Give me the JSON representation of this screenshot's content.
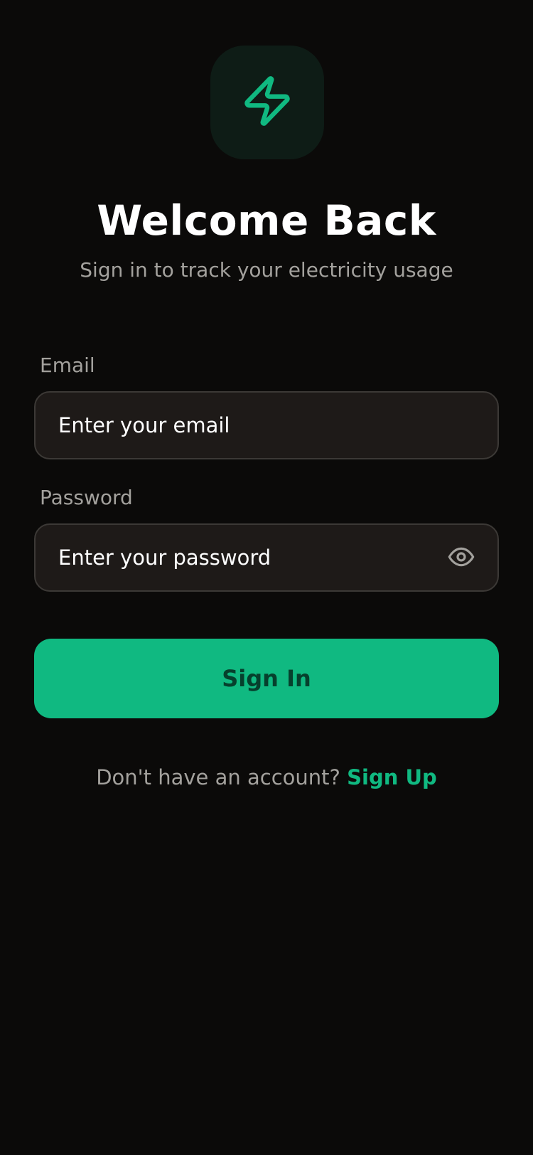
{
  "header": {
    "icon": "lightning-bolt-icon",
    "title": "Welcome Back",
    "subtitle": "Sign in to track your electricity usage"
  },
  "form": {
    "email": {
      "label": "Email",
      "value": "",
      "placeholder": "Enter your email"
    },
    "password": {
      "label": "Password",
      "value": "",
      "placeholder": "Enter your password",
      "toggle_icon": "eye-icon"
    },
    "submit_label": "Sign In"
  },
  "footer": {
    "prompt": "Don't have an account?",
    "link_label": "Sign Up"
  },
  "colors": {
    "background": "#0b0a09",
    "accent": "#10b981",
    "icon_tile": "#0e1c16",
    "input_background": "#1e1a18",
    "input_border": "#3c3936",
    "muted_text": "#a3a19d"
  }
}
